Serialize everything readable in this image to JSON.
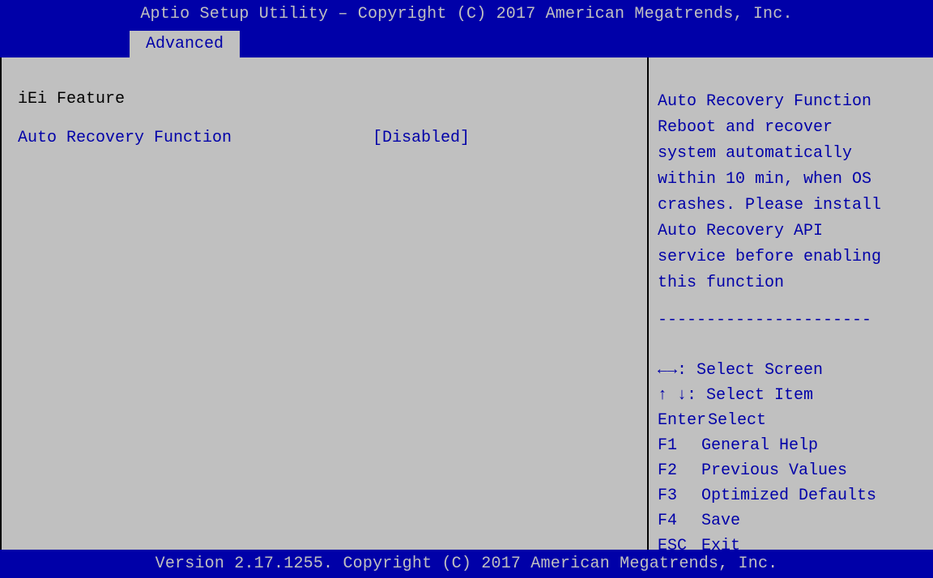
{
  "header": {
    "title": "Aptio Setup Utility – Copyright (C) 2017 American Megatrends, Inc."
  },
  "tabs": [
    {
      "label": "Advanced"
    }
  ],
  "main": {
    "section_title": "iEi Feature",
    "settings": [
      {
        "label": "Auto Recovery Function",
        "value": "[Disabled]"
      }
    ]
  },
  "help": {
    "lines": [
      "Auto Recovery Function",
      "Reboot and recover",
      "system automatically",
      "within 10 min, when OS",
      "crashes. Please install",
      "Auto Recovery API",
      "service before enabling",
      "this function"
    ],
    "separator": "----------------------"
  },
  "keys": [
    {
      "key": "←→",
      "desc": ": Select Screen"
    },
    {
      "key": "↑ ↓",
      "desc": ": Select Item"
    },
    {
      "key": "Enter",
      "desc": "Select"
    },
    {
      "key": "F1",
      "desc": "General Help"
    },
    {
      "key": "F2",
      "desc": "Previous Values"
    },
    {
      "key": "F3",
      "desc": "Optimized Defaults"
    },
    {
      "key": "F4",
      "desc": "Save"
    },
    {
      "key": "ESC",
      "desc": "Exit"
    }
  ],
  "footer": {
    "text": "Version 2.17.1255. Copyright (C) 2017 American Megatrends, Inc."
  },
  "colors": {
    "background": "#c0c0c0",
    "bar": "#0000a8",
    "text_blue": "#0000a8"
  }
}
